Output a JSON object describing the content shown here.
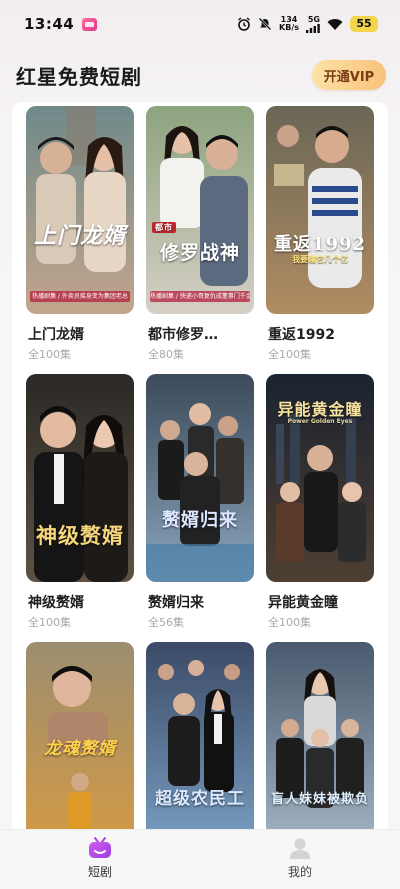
{
  "status_bar": {
    "time": "13:44",
    "net_speed_value": "134",
    "net_speed_unit": "KB/s",
    "network": "5G",
    "battery": "55"
  },
  "header": {
    "title": "红星免费短剧",
    "vip_label": "开通VIP"
  },
  "dramas": [
    {
      "title": "上门龙婿",
      "count": "全100集",
      "poster_text": "上门龙婿",
      "poster_tag": "热播剧集 / 外卖员摇身变为集团老总",
      "colors": [
        "#7a8a78",
        "#c9a48c"
      ]
    },
    {
      "title": "都市修罗…",
      "count": "全80集",
      "poster_text": "修罗战神",
      "poster_small": "都市",
      "poster_tag": "热播剧集 / 快递小哥复仇成董事门千金",
      "colors": [
        "#93a58a",
        "#d8d0c4"
      ]
    },
    {
      "title": "重返1992",
      "count": "全100集",
      "poster_text": "重返1992",
      "poster_sub": "我要赚它几个亿",
      "colors": [
        "#6f6a5c",
        "#a9865f"
      ]
    },
    {
      "title": "神级赘婿",
      "count": "全100集",
      "poster_text": "神级赘婿",
      "colors": [
        "#2c2a28",
        "#6a5a4a"
      ]
    },
    {
      "title": "赘婿归来",
      "count": "全56集",
      "poster_text": "赘婿归来",
      "colors": [
        "#3d4a5a",
        "#8aa2b8"
      ]
    },
    {
      "title": "异能黄金瞳",
      "count": "全100集",
      "poster_text": "异能黄金瞳",
      "poster_sub": "Power Golden Eyes",
      "colors": [
        "#1b2430",
        "#5a4b3c"
      ]
    },
    {
      "title": "",
      "count": "",
      "poster_text": "龙魂赘婿",
      "colors": [
        "#9a8a6a",
        "#d8a44a"
      ]
    },
    {
      "title": "",
      "count": "",
      "poster_text": "超级农民工",
      "colors": [
        "#3b4a66",
        "#7da4c8"
      ]
    },
    {
      "title": "",
      "count": "",
      "poster_text": "盲人妹妹被欺负",
      "colors": [
        "#4b5a6e",
        "#a8b8c8"
      ]
    }
  ],
  "bottom_nav": {
    "items": [
      {
        "label": "短剧",
        "icon": "tv-icon",
        "active": true
      },
      {
        "label": "我的",
        "icon": "profile-icon",
        "active": false
      }
    ]
  },
  "theme": {
    "vip_gradient": [
      "#fde2a6",
      "#f8c27a"
    ],
    "active_nav_color": "#b544e6"
  }
}
